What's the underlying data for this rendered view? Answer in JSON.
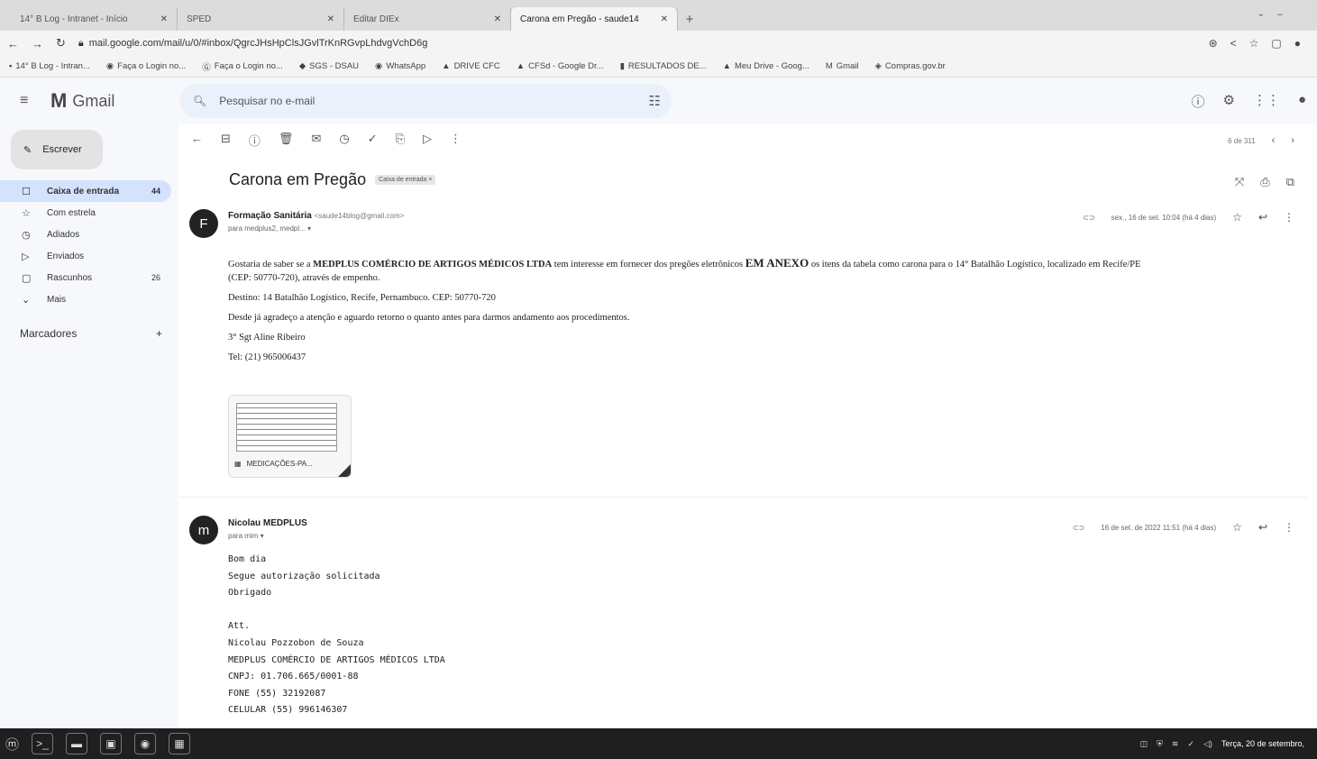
{
  "browser": {
    "tabs": [
      {
        "title": "14° B Log - Intranet - Início",
        "active": false
      },
      {
        "title": "SPED",
        "active": false
      },
      {
        "title": "Editar DIEx",
        "active": false
      },
      {
        "title": "Carona em Pregão - saude14",
        "active": true
      }
    ],
    "url": "mail.google.com/mail/u/0/#inbox/QgrcJHsHpClsJGvlTrKnRGvpLhdvgVchD6g",
    "bookmarks": [
      "14° B Log - Intran...",
      "Faça o Login no...",
      "Faça o Login no...",
      "SGS - DSAU",
      "WhatsApp",
      "DRIVE CFC",
      "CFSd - Google Dr...",
      "RESULTADOS DE...",
      "Meu Drive - Goog...",
      "Gmail",
      "Compras.gov.br"
    ]
  },
  "gmail": {
    "app_name": "Gmail",
    "search_placeholder": "Pesquisar no e-mail",
    "compose_label": "Escrever",
    "nav": [
      {
        "label": "Caixa de entrada",
        "count": "44",
        "icon": "inbox-icon",
        "glyph": "☐",
        "selected": true
      },
      {
        "label": "Com estrela",
        "count": "",
        "icon": "star-icon",
        "glyph": "☆",
        "selected": false
      },
      {
        "label": "Adiados",
        "count": "",
        "icon": "clock-icon",
        "glyph": "◷",
        "selected": false
      },
      {
        "label": "Enviados",
        "count": "",
        "icon": "send-icon",
        "glyph": "▷",
        "selected": false
      },
      {
        "label": "Rascunhos",
        "count": "26",
        "icon": "draft-icon",
        "glyph": "▢",
        "selected": false
      },
      {
        "label": "Mais",
        "count": "",
        "icon": "expand-icon",
        "glyph": "⌄",
        "selected": false
      }
    ],
    "labels_heading": "Marcadores",
    "pager_text": "6 de 311"
  },
  "thread": {
    "subject": "Carona em Pregão",
    "tag": "Caixa de entrada ×",
    "messages": [
      {
        "avatar": "F",
        "sender_name": "Formação Sanitária",
        "sender_email": "<saude14blog@gmail.com>",
        "to": "para medplus2, medpl... ▾",
        "date": "sex., 16 de set. 10:04 (há 4 dias)"
      },
      {
        "avatar": "m",
        "sender_name": "Nicolau MEDPLUS",
        "sender_email": "",
        "to": "para mim ▾",
        "date": "16 de set. de 2022 11:51 (há 4 dias)"
      }
    ],
    "body1": {
      "p1_pre": "Gostaria de saber se a ",
      "p1_company": "MEDPLUS COMÉRCIO DE ARTIGOS MÉDICOS LTDA",
      "p1_mid": " tem interesse em fornecer dos pregões eletrônicos ",
      "p1_annex": "EM ANEXO",
      "p1_post": " os itens da tabela como carona para o 14° Batalhão Logístico, localizado em Recife/PE",
      "p1_line2": "(CEP: 50770-720), através de empenho.",
      "destino": "Destino: 14 Batalhão Logístico, Recife, Pernambuco. CEP: 50770-720",
      "agradeco": "Desde já agradeço a atenção e aguardo retorno o quanto antes para darmos andamento aos procedimentos.",
      "sig_name": "3° Sgt Aline Ribeiro",
      "sig_tel": "Tel: (21) 965006437"
    },
    "attachment_name": "MEDICAÇÕES-PA...",
    "body2": {
      "l1": "Bom dia",
      "l2": "Segue autorização solicitada",
      "l3": "Obrigado",
      "l4": "Att.",
      "l5": "Nicolau Pozzobon  de Souza",
      "l6": "MEDPLUS COMÉRCIO DE ARTIGOS MÉDICOS LTDA",
      "l7": "CNPJ: 01.706.665/0001-88",
      "l8": "FONE (55) 32192087",
      "l9": "CELULAR (55) 996146307"
    }
  },
  "taskbar": {
    "clock": "Terça, 20 de setembro,"
  },
  "colors": {
    "selected_nav": "#d3e3fd",
    "search_bg": "#eaf1fb",
    "sidebar_bg": "#f6f8fc",
    "taskbar": "#1f1f1f"
  }
}
